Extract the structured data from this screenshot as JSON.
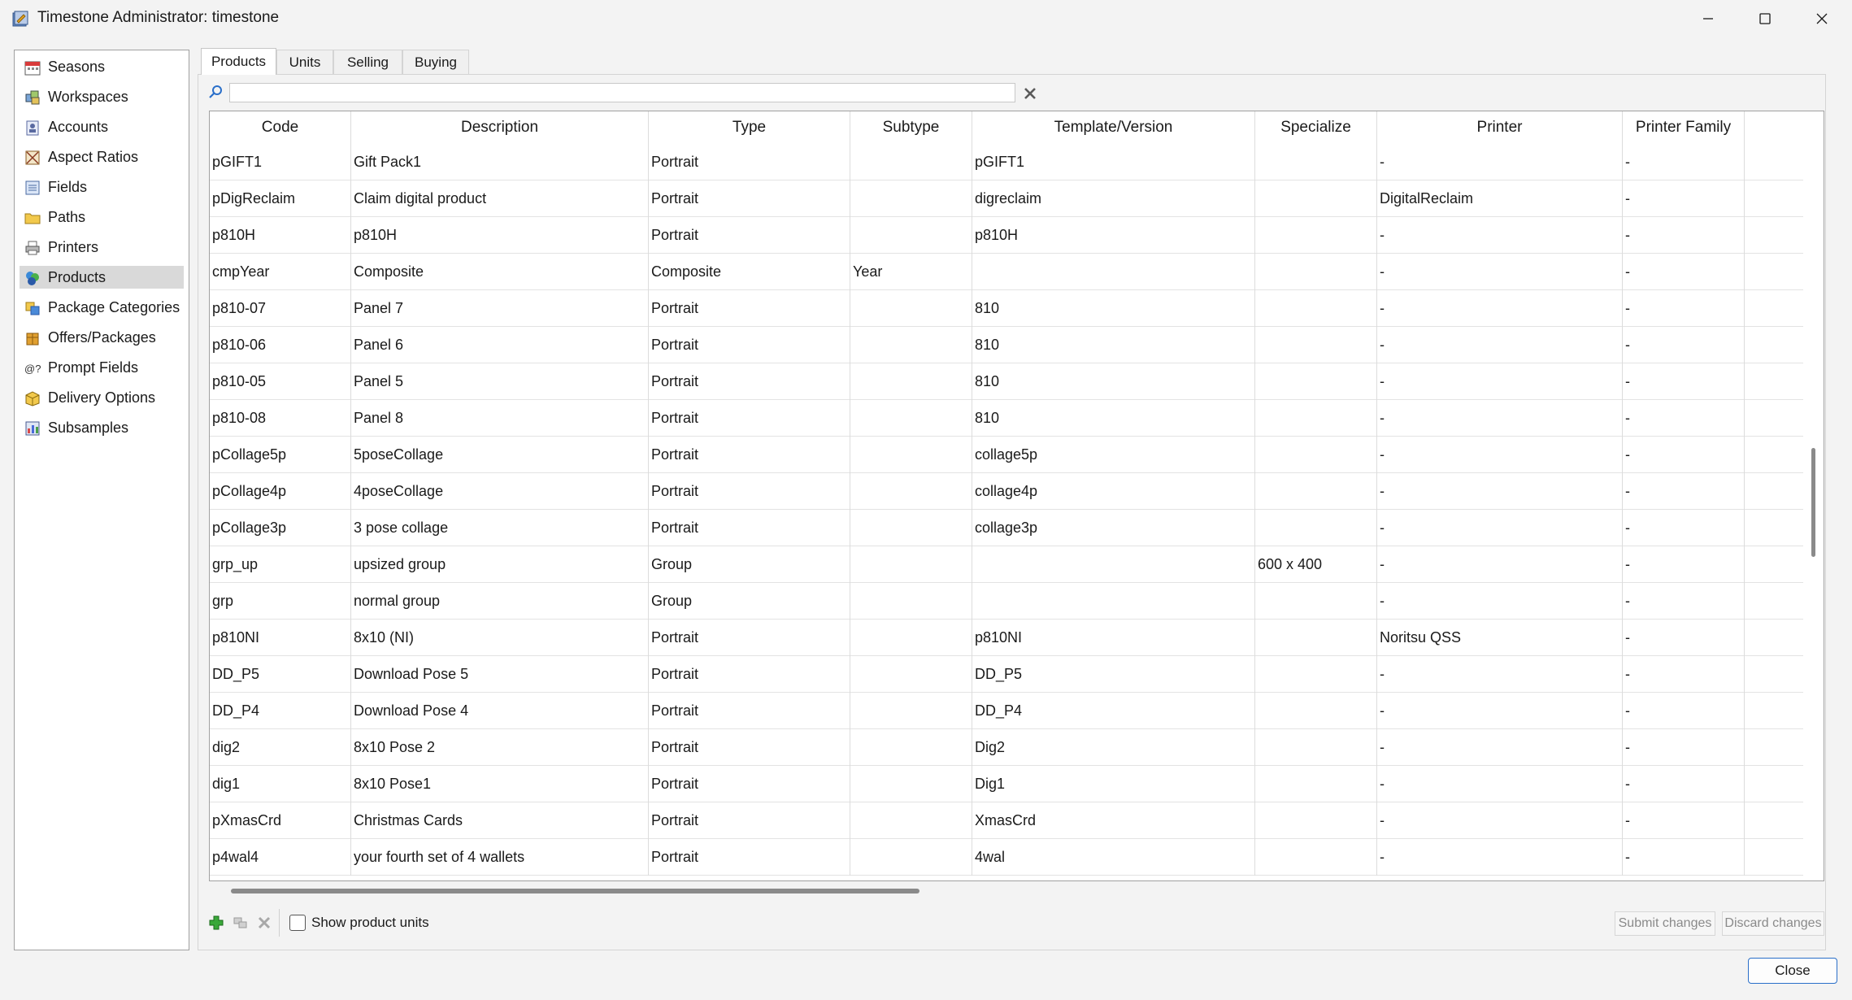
{
  "window": {
    "title": "Timestone Administrator: timestone"
  },
  "sidebar": {
    "items": [
      {
        "label": "Seasons",
        "icon": "calendar-icon"
      },
      {
        "label": "Workspaces",
        "icon": "workspace-icon"
      },
      {
        "label": "Accounts",
        "icon": "accounts-icon"
      },
      {
        "label": "Aspect Ratios",
        "icon": "aspect-ratio-icon"
      },
      {
        "label": "Fields",
        "icon": "fields-icon"
      },
      {
        "label": "Paths",
        "icon": "folder-icon"
      },
      {
        "label": "Printers",
        "icon": "printer-icon"
      },
      {
        "label": "Products",
        "icon": "products-icon",
        "selected": true
      },
      {
        "label": "Package Categories",
        "icon": "package-categories-icon"
      },
      {
        "label": "Offers/Packages",
        "icon": "package-icon"
      },
      {
        "label": "Prompt Fields",
        "icon": "prompt-fields-icon"
      },
      {
        "label": "Delivery Options",
        "icon": "delivery-box-icon"
      },
      {
        "label": "Subsamples",
        "icon": "subsamples-icon"
      }
    ]
  },
  "tabs": [
    {
      "label": "Products",
      "active": true
    },
    {
      "label": "Units"
    },
    {
      "label": "Selling"
    },
    {
      "label": "Buying"
    }
  ],
  "search": {
    "value": "",
    "placeholder": ""
  },
  "table": {
    "columns": [
      "Code",
      "Description",
      "Type",
      "Subtype",
      "Template/Version",
      "Specialize",
      "Printer",
      "Printer Family"
    ],
    "rows": [
      [
        "pGIFT1",
        "Gift Pack1",
        "Portrait",
        "",
        "pGIFT1",
        "",
        "-",
        "-"
      ],
      [
        "pDigReclaim",
        "Claim digital product",
        "Portrait",
        "",
        "digreclaim",
        "",
        "DigitalReclaim",
        "-"
      ],
      [
        "p810H",
        "p810H",
        "Portrait",
        "",
        "p810H",
        "",
        "-",
        "-"
      ],
      [
        "cmpYear",
        "Composite",
        "Composite",
        "Year",
        "",
        "",
        "-",
        "-"
      ],
      [
        "p810-07",
        "Panel 7",
        "Portrait",
        "",
        "810",
        "",
        "-",
        "-"
      ],
      [
        "p810-06",
        "Panel 6",
        "Portrait",
        "",
        "810",
        "",
        "-",
        "-"
      ],
      [
        "p810-05",
        "Panel 5",
        "Portrait",
        "",
        "810",
        "",
        "-",
        "-"
      ],
      [
        "p810-08",
        "Panel 8",
        "Portrait",
        "",
        "810",
        "",
        "-",
        "-"
      ],
      [
        "pCollage5p",
        "5poseCollage",
        "Portrait",
        "",
        "collage5p",
        "",
        "-",
        "-"
      ],
      [
        "pCollage4p",
        "4poseCollage",
        "Portrait",
        "",
        "collage4p",
        "",
        "-",
        "-"
      ],
      [
        "pCollage3p",
        "3 pose collage",
        "Portrait",
        "",
        "collage3p",
        "",
        "-",
        "-"
      ],
      [
        "grp_up",
        "upsized group",
        "Group",
        "",
        "",
        "600 x 400",
        "-",
        "-"
      ],
      [
        "grp",
        "normal group",
        "Group",
        "",
        "",
        "",
        "-",
        "-"
      ],
      [
        "p810NI",
        "8x10 (NI)",
        "Portrait",
        "",
        "p810NI",
        "",
        "Noritsu QSS",
        "-"
      ],
      [
        "DD_P5",
        "Download Pose 5",
        "Portrait",
        "",
        "DD_P5",
        "",
        "-",
        "-"
      ],
      [
        "DD_P4",
        "Download Pose 4",
        "Portrait",
        "",
        "DD_P4",
        "",
        "-",
        "-"
      ],
      [
        "dig2",
        "8x10 Pose 2",
        "Portrait",
        "",
        "Dig2",
        "",
        "-",
        "-"
      ],
      [
        "dig1",
        "8x10 Pose1",
        "Portrait",
        "",
        "Dig1",
        "",
        "-",
        "-"
      ],
      [
        "pXmasCrd",
        "Christmas Cards",
        "Portrait",
        "",
        "XmasCrd",
        "",
        "-",
        "-"
      ],
      [
        "p4wal4",
        "your fourth set of 4 wallets",
        "Portrait",
        "",
        "4wal",
        "",
        "-",
        "-"
      ]
    ]
  },
  "toolbar": {
    "add_icon": "add-icon",
    "duplicate_icon": "duplicate-icon",
    "delete_icon": "delete-icon",
    "show_units_label": "Show product units",
    "show_units_checked": false,
    "submit_label": "Submit changes",
    "discard_label": "Discard changes"
  },
  "footer": {
    "close_label": "Close"
  },
  "colors": {
    "accent": "#2a6fc9",
    "selection": "#d9d9d9"
  }
}
